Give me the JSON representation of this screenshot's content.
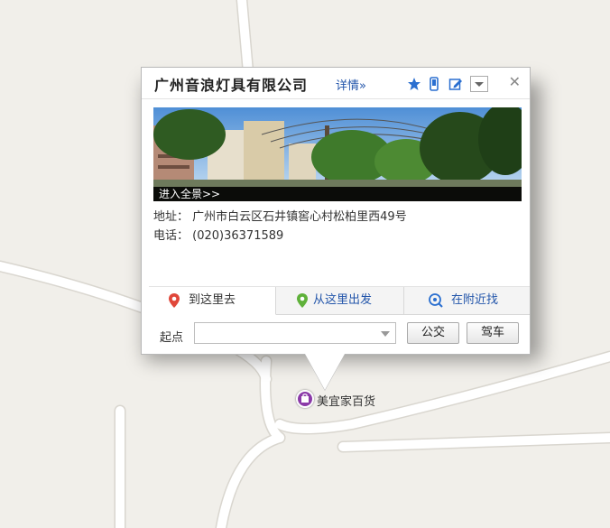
{
  "popup": {
    "title": "广州音浪灯具有限公司",
    "detail_link": "详情»",
    "panorama_label": "进入全景>>",
    "address_label": "地址：",
    "address": "广州市白云区石井镇窖心村松柏里西49号",
    "phone_label": "电话：",
    "phone": "(020)36371589",
    "tabs": [
      "到这里去",
      "从这里出发",
      "在附近找"
    ],
    "start_label": "起点",
    "start_value": "",
    "bus_button": "公交",
    "drive_button": "驾车"
  },
  "poi": {
    "name": "美宜家百货"
  },
  "colors": {
    "link": "#2255aa",
    "poi": "#8b3aa8",
    "map_bg": "#f1efea",
    "road": "#ffffff"
  }
}
